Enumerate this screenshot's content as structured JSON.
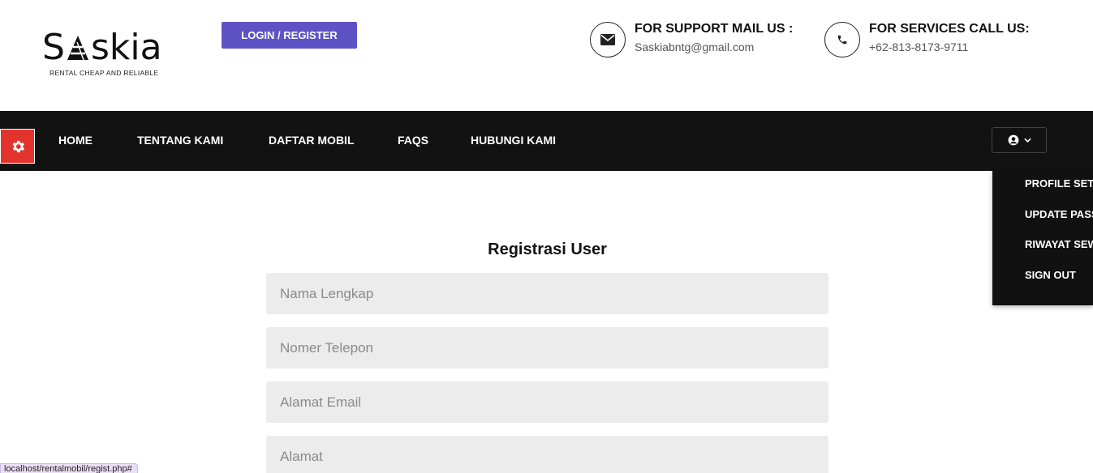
{
  "brand": {
    "name_prefix": "S",
    "name_suffix": "skia",
    "tagline": "RENTAL CHEAP AND RELIABLE"
  },
  "header": {
    "login_label": "LOGIN / REGISTER",
    "support": {
      "title": "FOR SUPPORT MAIL US :",
      "value": "Saskiabntg@gmail.com",
      "icon": "envelope-icon"
    },
    "services": {
      "title": "FOR SERVICES CALL US:",
      "value": "+62-813-8173-9711",
      "icon": "phone-icon"
    }
  },
  "nav": {
    "items": [
      "HOME",
      "TENTANG KAMI",
      "DAFTAR MOBIL",
      "FAQS",
      "HUBUNGI KAMI"
    ],
    "gear_icon": "gear-icon",
    "user_icon": "user-circle-icon"
  },
  "user_menu": {
    "items": [
      "PROFILE SETTINGS",
      "UPDATE PASSWORD",
      "RIWAYAT SEWA",
      "SIGN OUT"
    ]
  },
  "form": {
    "title": "Registrasi User",
    "fields": [
      {
        "placeholder": "Nama Lengkap"
      },
      {
        "placeholder": "Nomer Telepon"
      },
      {
        "placeholder": "Alamat Email"
      },
      {
        "placeholder": "Alamat"
      }
    ]
  },
  "status_bar": {
    "url": "localhost/rentalmobil/regist.php#"
  },
  "colors": {
    "accent": "#5f52c4",
    "nav_bg": "#121212",
    "gear_bg": "#e2342d",
    "field_bg": "#ececec"
  }
}
